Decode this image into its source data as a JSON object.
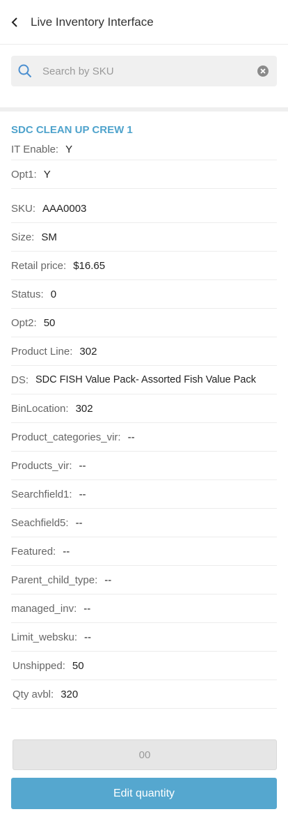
{
  "header": {
    "title": "Live Inventory Interface"
  },
  "search": {
    "placeholder": "Search by SKU",
    "value": ""
  },
  "card": {
    "title": "SDC CLEAN UP CREW 1",
    "rows": [
      {
        "label": "IT Enable:",
        "value": "Y"
      },
      {
        "label": "Opt1:",
        "value": "Y"
      },
      {
        "label": "SKU:",
        "value": "AAA0003"
      },
      {
        "label": "Size:",
        "value": "SM"
      },
      {
        "label": "Retail price:",
        "value": "$16.65"
      },
      {
        "label": "Status:",
        "value": "0"
      },
      {
        "label": "Opt2:",
        "value": "50"
      },
      {
        "label": "Product Line:",
        "value": "302"
      },
      {
        "label": "DS:",
        "value": "SDC FISH Value Pack- Assorted Fish Value Pack"
      },
      {
        "label": "BinLocation:",
        "value": "302"
      },
      {
        "label": "Product_categories_vir:",
        "value": "--"
      },
      {
        "label": "Products_vir:",
        "value": "--"
      },
      {
        "label": "Searchfield1:",
        "value": "--"
      },
      {
        "label": "Seachfield5:",
        "value": "--"
      },
      {
        "label": "Featured:",
        "value": "--"
      },
      {
        "label": "Parent_child_type:",
        "value": "--"
      },
      {
        "label": "managed_inv:",
        "value": "--"
      },
      {
        "label": "Limit_websku:",
        "value": "--"
      },
      {
        "label": "Unshipped:",
        "value": "50"
      },
      {
        "label": "Qty avbl:",
        "value": "320"
      }
    ]
  },
  "quantity_input": {
    "value": "00"
  },
  "edit_button": {
    "label": "Edit quantity"
  },
  "colors": {
    "accent": "#55a7cf",
    "title": "#4fa3cc"
  }
}
